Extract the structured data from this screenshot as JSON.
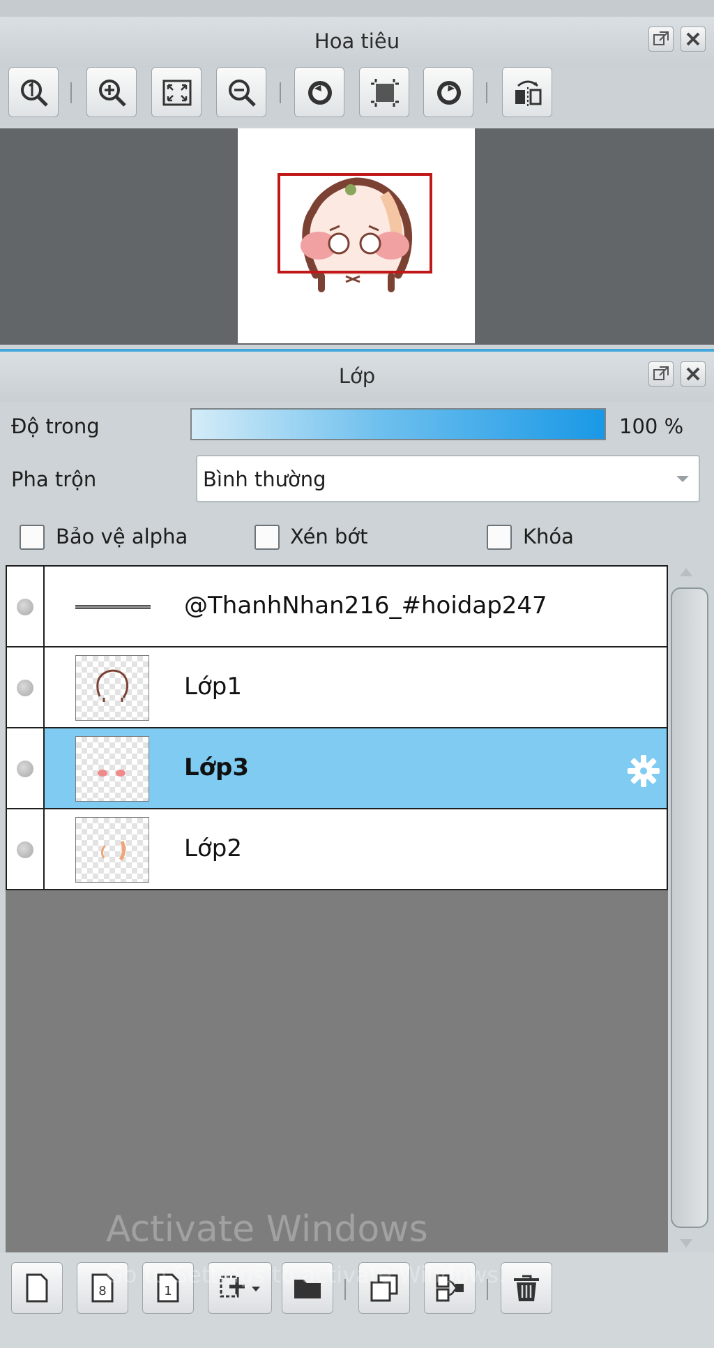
{
  "navigator": {
    "title": "Hoa tiêu",
    "tools": [
      {
        "icon": "zoom-actual-size-icon"
      },
      {
        "icon": "zoom-in-icon"
      },
      {
        "icon": "fit-window-icon"
      },
      {
        "icon": "zoom-out-icon"
      },
      {
        "icon": "rotate-left-icon"
      },
      {
        "icon": "reset-view-icon"
      },
      {
        "icon": "rotate-right-icon"
      },
      {
        "icon": "flip-horizontal-icon"
      }
    ]
  },
  "layers_panel": {
    "title": "Lớp",
    "opacity_label": "Độ trong",
    "opacity_value": "100 %",
    "opacity_fraction": 1.0,
    "blend_label": "Pha trộn",
    "blend_value": "Bình thường",
    "checkboxes": {
      "alpha_protect": "Bảo vệ alpha",
      "clipping": "Xén bớt",
      "lock": "Khóa"
    },
    "layers": [
      {
        "name": "@ThanhNhan216_#hoidap247",
        "selected": false,
        "thumb": "text-line"
      },
      {
        "name": "Lớp1",
        "selected": false,
        "thumb": "outline"
      },
      {
        "name": "Lớp3",
        "selected": true,
        "thumb": "cheeks"
      },
      {
        "name": "Lớp2",
        "selected": false,
        "thumb": "blush"
      }
    ]
  },
  "bottom_toolbar": [
    {
      "icon": "new-layer-icon"
    },
    {
      "icon": "new-8bit-layer-icon"
    },
    {
      "icon": "new-1bit-layer-icon"
    },
    {
      "icon": "add-layer-dropdown-icon"
    },
    {
      "icon": "new-folder-icon"
    },
    {
      "icon": "duplicate-layer-icon"
    },
    {
      "icon": "merge-layer-icon"
    },
    {
      "icon": "delete-layer-icon"
    }
  ],
  "watermark": {
    "line1": "Activate Windows",
    "line2": "Go to Settings to activate Windows."
  },
  "colors": {
    "accent": "#42a6dc",
    "selected_row": "#7fcbf1",
    "frame": "#c01818"
  }
}
